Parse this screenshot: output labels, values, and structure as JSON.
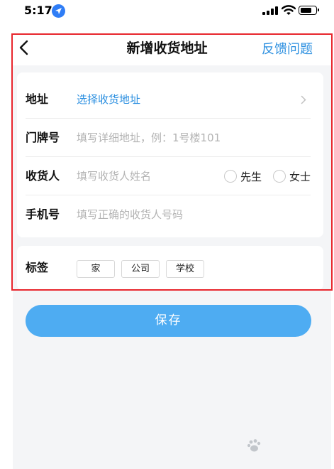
{
  "status_bar": {
    "time": "5:17"
  },
  "nav": {
    "title": "新增收货地址",
    "feedback_label": "反馈问题"
  },
  "form": {
    "address": {
      "label": "地址",
      "value": "选择收货地址"
    },
    "door_number": {
      "label": "门牌号",
      "placeholder": "填写详细地址，例：1号楼101"
    },
    "recipient": {
      "label": "收货人",
      "placeholder": "填写收货人姓名",
      "options": [
        "先生",
        "女士"
      ]
    },
    "phone": {
      "label": "手机号",
      "placeholder": "填写正确的收货人号码"
    }
  },
  "tags": {
    "label": "标签",
    "items": [
      "家",
      "公司",
      "学校"
    ]
  },
  "save_label": "保存",
  "colors": {
    "accent": "#2b8fe0",
    "save_button": "#4eacf2",
    "highlight": "#e8262d",
    "page_background": "#f4f5f7"
  },
  "icons": [
    "location-arrow-icon",
    "signal-icon",
    "wifi-icon",
    "battery-icon",
    "back-arrow-icon",
    "chevron-right-icon",
    "baidu-paw-icon"
  ]
}
